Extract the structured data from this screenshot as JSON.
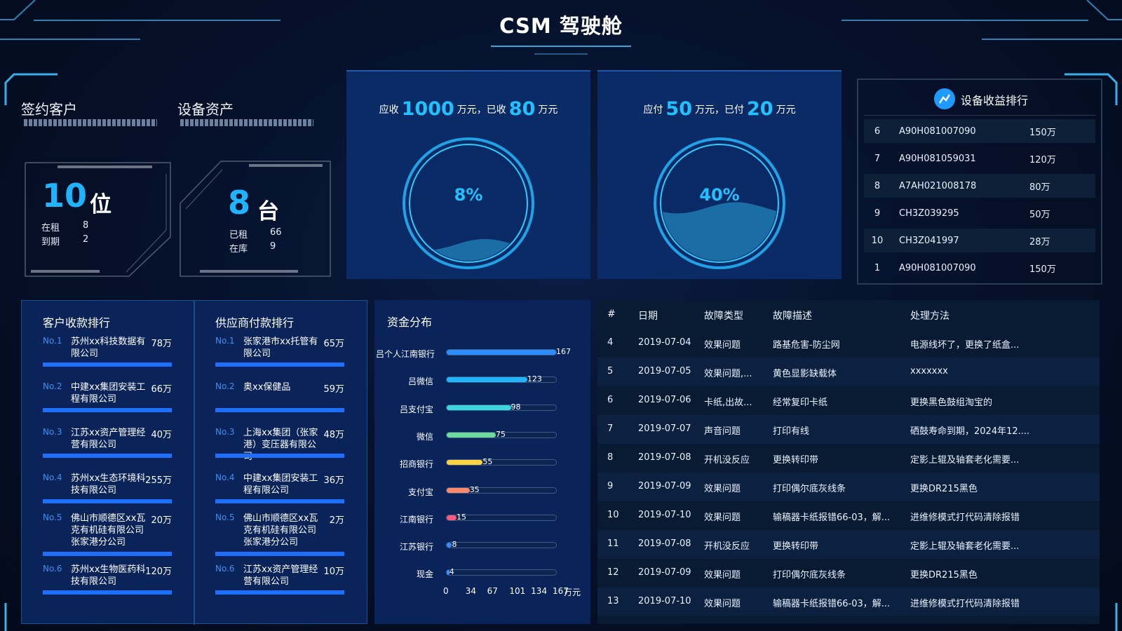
{
  "header": {
    "title": "CSM 驾驶舱"
  },
  "customers": {
    "label": "签约客户",
    "count": "10",
    "unit": "位",
    "rows": [
      {
        "k": "在租",
        "v": "8"
      },
      {
        "k": "到期",
        "v": "2"
      }
    ]
  },
  "assets": {
    "label": "设备资产",
    "count": "8",
    "unit": "台",
    "rows": [
      {
        "k": "已租",
        "v": "66"
      },
      {
        "k": "在库",
        "v": "9"
      }
    ]
  },
  "receivable": {
    "t1": "应收",
    "v1": "1000",
    "t2": "万元，已收",
    "v2": "80",
    "t3": "万元",
    "percent_label": "8%",
    "percent": 0.08
  },
  "payable": {
    "t1": "应付",
    "v1": "50",
    "t2": "万元，已付",
    "v2": "20",
    "t3": "万元",
    "percent_label": "40%",
    "percent": 0.4
  },
  "equipment_rank": {
    "title": "设备收益排行",
    "icon": "chart-icon",
    "rows": [
      {
        "no": "6",
        "id": "A90H081007090",
        "amount": "150万"
      },
      {
        "no": "7",
        "id": "A90H081059031",
        "amount": "120万"
      },
      {
        "no": "8",
        "id": "A7AH021008178",
        "amount": "80万"
      },
      {
        "no": "9",
        "id": "CH3Z039295",
        "amount": "50万"
      },
      {
        "no": "10",
        "id": "CH3Z041997",
        "amount": "28万"
      },
      {
        "no": "1",
        "id": "A90H081007090",
        "amount": "150万"
      }
    ]
  },
  "customer_rank": {
    "title": "客户收款排行",
    "items": [
      {
        "no": "No.1",
        "name": "苏州xx科技数据有限公司",
        "amount": "78万"
      },
      {
        "no": "No.2",
        "name": "中建xx集团安装工程有限公司",
        "amount": "66万"
      },
      {
        "no": "No.3",
        "name": "江苏xx资产管理经营有限公司",
        "amount": "40万"
      },
      {
        "no": "No.4",
        "name": "苏州xx生态环境科技有限公司",
        "amount": "255万"
      },
      {
        "no": "No.5",
        "name": "佛山市顺德区xx瓦克有机硅有限公司张家港分公司",
        "amount": "20万"
      },
      {
        "no": "No.6",
        "name": "苏州xx生物医药科技有限公司",
        "amount": "120万"
      }
    ]
  },
  "supplier_rank": {
    "title": "供应商付款排行",
    "items": [
      {
        "no": "No.1",
        "name": "张家港市xx托管有限公司",
        "amount": "65万"
      },
      {
        "no": "No.2",
        "name": "奥xx保健品",
        "amount": "59万"
      },
      {
        "no": "No.3",
        "name": "上海xx集团（张家港）变压器有限公司",
        "amount": "48万"
      },
      {
        "no": "No.4",
        "name": "中建xx集团安装工程有限公司",
        "amount": "36万"
      },
      {
        "no": "No.5",
        "name": "佛山市顺德区xx瓦克有机硅有限公司张家港分公司",
        "amount": "2万"
      },
      {
        "no": "No.6",
        "name": "江苏xx资产管理经营有限公司",
        "amount": "10万"
      }
    ]
  },
  "fund": {
    "title": "资金分布",
    "chart_data": {
      "type": "bar",
      "orientation": "horizontal",
      "title": "资金分布",
      "categories": [
        "吕个人江南银行",
        "吕微信",
        "吕支付宝",
        "微信",
        "招商银行",
        "支付宝",
        "江南银行",
        "江苏银行",
        "现金"
      ],
      "values": [
        167,
        123,
        98,
        75,
        55,
        35,
        15,
        8,
        4
      ],
      "colors": [
        "#2f8cff",
        "#1fb6ff",
        "#3dd6e0",
        "#6ddc9a",
        "#ffd23f",
        "#ff8a6b",
        "#ff5a7a",
        "#3a8dff",
        "#3a8dff"
      ],
      "xticks": [
        "0",
        "34",
        "67",
        "101",
        "134",
        "167"
      ],
      "xmax": 167,
      "xunit": "万元"
    }
  },
  "faults": {
    "headers": [
      "#",
      "日期",
      "故障类型",
      "故障描述",
      "处理方法"
    ],
    "rows": [
      [
        "4",
        "2019-07-04",
        "效果问题",
        "路基危害-防尘网",
        "电源线坏了，更换了纸盒..."
      ],
      [
        "5",
        "2019-07-05",
        "效果问题,...",
        "黄色显影缺载体",
        "xxxxxxx"
      ],
      [
        "6",
        "2019-07-06",
        "卡纸,出故...",
        "经常复印卡纸",
        "更换黑色鼓组淘宝的"
      ],
      [
        "7",
        "2019-07-07",
        "声音问题",
        "打印有线",
        "硒鼓寿命到期，2024年12...."
      ],
      [
        "8",
        "2019-07-08",
        "开机没反应",
        "更换转印带",
        "定影上辊及轴套老化需要..."
      ],
      [
        "9",
        "2019-07-09",
        "效果问题",
        "打印偶尔底灰线条",
        "更换DR215黑色"
      ],
      [
        "10",
        "2019-07-10",
        "效果问题",
        "输稿器卡纸报错66-03，解...",
        "进维修模式打代码清除报错"
      ],
      [
        "11",
        "2019-07-08",
        "开机没反应",
        "更换转印带",
        "定影上辊及轴套老化需要..."
      ],
      [
        "12",
        "2019-07-09",
        "效果问题",
        "打印偶尔底灰线条",
        "更换DR215黑色"
      ],
      [
        "13",
        "2019-07-10",
        "效果问题",
        "输稿器卡纸报错66-03，解...",
        "进维修模式打代码清除报错"
      ]
    ]
  }
}
